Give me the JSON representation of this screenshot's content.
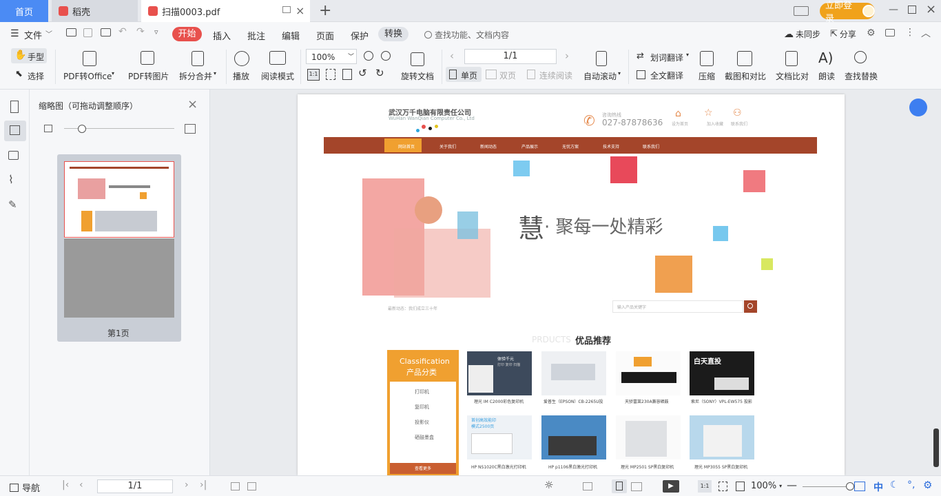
{
  "tabs": {
    "home": "首页",
    "daoke": "稻壳",
    "file": "扫描0003.pdf"
  },
  "login": "立即登录",
  "menu": {
    "file": "文件",
    "items": [
      "开始",
      "插入",
      "批注",
      "编辑",
      "页面",
      "保护",
      "转换"
    ],
    "search_placeholder": "查找功能、文档内容",
    "sync": "未同步",
    "share": "分享"
  },
  "ribbon": {
    "hand": "手型",
    "select": "选择",
    "pdf_office": "PDF转Office",
    "pdf_image": "PDF转图片",
    "split_merge": "拆分合并",
    "play": "播放",
    "read_mode": "阅读模式",
    "zoom": "100%",
    "rotate": "旋转文档",
    "page_input": "1/1",
    "single": "单页",
    "double": "双页",
    "continuous": "连续阅读",
    "auto_scroll": "自动滚动",
    "word_translate": "划词翻译",
    "full_translate": "全文翻译",
    "compress": "压缩",
    "screenshot_compare": "截图和对比",
    "doc_compare": "文档比对",
    "read_aloud": "朗读",
    "find_replace": "查找替换"
  },
  "thumb": {
    "title": "缩略图（可拖动调整顺序）",
    "page_label": "第1页"
  },
  "doc": {
    "company": "武汉万千电脑有限责任公司",
    "company_en": "WuHan WanQian Computer Co., Ltd",
    "hotline_label": "咨询热线",
    "hotline": "027-87878636",
    "header_links": [
      "设为首页",
      "加入收藏",
      "联系我们"
    ],
    "nav": [
      "网站首页",
      "关于我们",
      "新闻动态",
      "产品展示",
      "无忧方案",
      "技术支持",
      "联系我们"
    ],
    "banner_char": "慧",
    "banner_text": "· 聚每一处精彩",
    "marquee": "最新动态：我们成立三十年",
    "search_placeholder": "输入产品关键字",
    "products_en": "PRDUCTS",
    "products_title": "优品推荐",
    "cat_en": "Classification",
    "cat_cn": "产品分类",
    "categories": [
      "打印机",
      "复印机",
      "投影仪",
      "硒鼓墨盒"
    ],
    "cat_more": "查看更多",
    "products": [
      "理光 IM C2000彩色复印机",
      "爱普生（EPSON）CB-2265U投",
      "天骄富莱230A兼容硒鼓",
      "索尼（SONY）VPL-EW575 投影",
      "HP NS1020C黑白激光打印机",
      "HP p1106黑白激光打印机",
      "理光 MP2501 SP黑白复印机",
      "理光 MP3055 SP黑白复印机"
    ],
    "prod1_lines": [
      "体验千元",
      "打印 复印 扫描"
    ],
    "prod4_banner": "白天直投",
    "prod5_banner": "首创高效能印",
    "prod5_banner2": "模式2500页"
  },
  "status": {
    "nav": "导航",
    "page_input": "1/1",
    "zoom": "100%",
    "ime": "中"
  },
  "colors": {
    "accent": "#e8514d",
    "blue": "#4b8bf4",
    "login": "#f0a21b",
    "doc_nav": "#a4452a",
    "doc_orange": "#f0a030"
  }
}
